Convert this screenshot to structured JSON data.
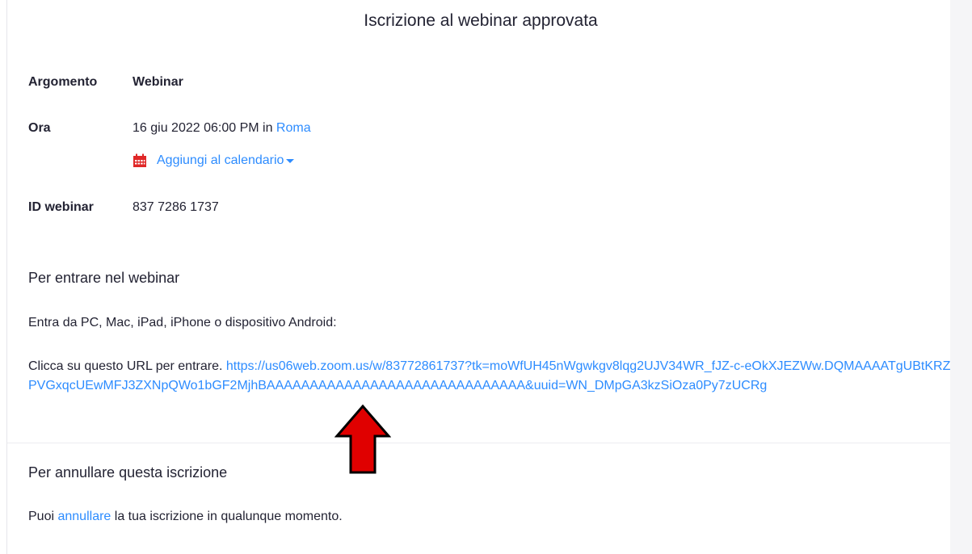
{
  "header": {
    "title": "Iscrizione al webinar approvata"
  },
  "details": {
    "topic_label": "Argomento",
    "topic_value": "Webinar",
    "time_label": "Ora",
    "time_value": "16 giu 2022 06:00 PM in",
    "timezone_link": "Roma",
    "calendar_link": "Aggiungi al calendario",
    "id_label": "ID webinar",
    "id_value": "837 7286 1737"
  },
  "join": {
    "heading": "Per entrare nel webinar",
    "devices_text": "Entra da PC, Mac, iPad, iPhone o dispositivo Android:",
    "url_prefix": "Clicca su questo URL per entrare.",
    "url": "https://us06web.zoom.us/w/83772861737?tk=moWfUH45nWgwkgv8lqg2UJV34WR_fJZ-c-eOkXJEZWw.DQMAAAATgUBtKRZPVGxqcUEwMFJ3ZXNpQWo1bGF2MjhBAAAAAAAAAAAAAAAAAAAAAAAAAAAAAA&uuid=WN_DMpGA3kzSiOza0Py7zUCRg"
  },
  "cancel": {
    "heading": "Per annullare questa iscrizione",
    "text_before": "Puoi",
    "link": "annullare",
    "text_after": "la tua iscrizione in qualunque momento."
  },
  "icons": {
    "calendar": "calendar-icon",
    "dropdown": "caret-down-icon",
    "annotation": "red-up-arrow"
  },
  "colors": {
    "link": "#2d8cff",
    "text": "#232333",
    "calendar_icon": "#e02828",
    "arrow": "#e00000"
  }
}
